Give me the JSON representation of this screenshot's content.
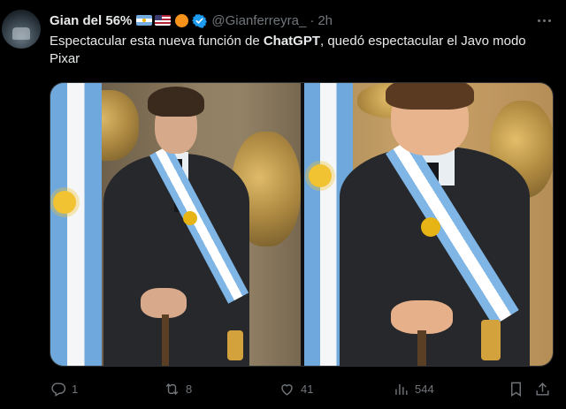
{
  "author": {
    "display_name": "Gian del 56%",
    "handle": "@Gianferreyra_",
    "separator": "·",
    "time": "2h"
  },
  "tweet": {
    "text_before": "Espectacular esta nueva función de ",
    "text_bold": "ChatGPT",
    "text_after": ", quedó espectacular el Javo modo Pixar"
  },
  "media": {
    "photo_count": 2
  },
  "actions": {
    "replies": "1",
    "retweets": "8",
    "likes": "41",
    "views": "544"
  },
  "colors": {
    "background": "#000000",
    "text_primary": "#e7e9ea",
    "text_secondary": "#71767b",
    "verified": "#1d9bf0",
    "border": "#2f3336"
  },
  "icons": [
    "avatar",
    "argentina-flag-icon",
    "usa-flag-icon",
    "orange-circle-icon",
    "verified-badge-icon",
    "more-icon",
    "reply-icon",
    "retweet-icon",
    "like-icon",
    "views-icon",
    "bookmark-icon",
    "share-icon"
  ]
}
